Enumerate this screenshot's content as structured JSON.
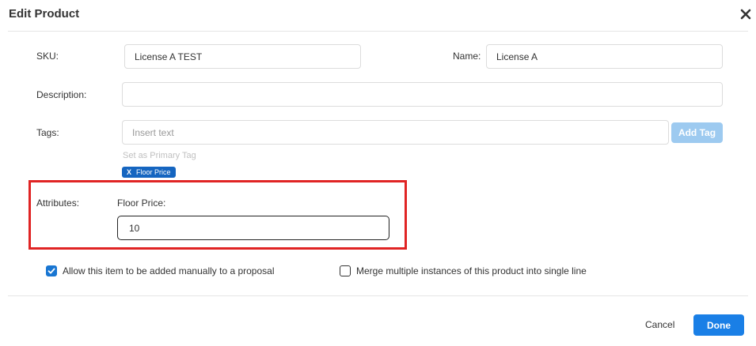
{
  "dialog": {
    "title": "Edit Product",
    "close_icon": "close-icon"
  },
  "form": {
    "sku": {
      "label": "SKU:",
      "value": "License A TEST"
    },
    "name": {
      "label": "Name:",
      "value": "License A"
    },
    "description": {
      "label": "Description:",
      "value": ""
    },
    "tags": {
      "label": "Tags:",
      "placeholder": "Insert text",
      "add_button": "Add Tag",
      "primary_hint": "Set as Primary Tag",
      "chips": [
        {
          "remove": "X",
          "label": "Floor Price"
        }
      ]
    },
    "attributes": {
      "label": "Attributes:",
      "floor_price": {
        "label": "Floor Price:",
        "value": "10"
      }
    },
    "options": {
      "allow_manual": {
        "label": "Allow this item to be added manually to a proposal",
        "checked": true
      },
      "merge_instances": {
        "label": "Merge multiple instances of this product into single line",
        "checked": false
      }
    }
  },
  "footer": {
    "cancel_label": "Cancel",
    "done_label": "Done"
  },
  "colors": {
    "primary": "#1a7fe6",
    "highlight": "#e02424",
    "chip": "#1565c0"
  }
}
